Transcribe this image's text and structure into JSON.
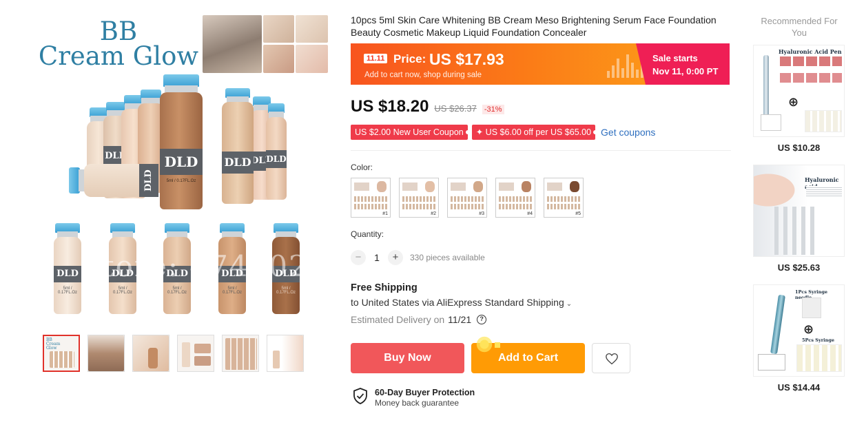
{
  "gallery": {
    "hero_title_line1": "BB",
    "hero_title_line2": "Cream Glow",
    "vial_label": "DLD",
    "vial_sub": "5ml / 0.17FL.Oz",
    "watermark": "Store: 4746024",
    "thumb_logo_text": "BB Cream Glow"
  },
  "product": {
    "title": "10pcs 5ml Skin Care Whitening BB Cream Meso Brightening Serum Face Foundation Beauty Cosmetic Makeup Liquid Foundation Concealer"
  },
  "sale_banner": {
    "tag": "11.11",
    "price_label": "Price:",
    "price_value": "US $17.93",
    "subtext": "Add to cart now, shop during sale",
    "start_line1": "Sale starts",
    "start_line2": "Nov 11, 0:00 PT"
  },
  "price": {
    "current": "US $18.20",
    "original": "US $26.37",
    "discount": "-31%"
  },
  "coupons": {
    "new_user": "US $2.00 New User Coupon",
    "store": "✦ US $6.00 off per US $65.00",
    "get_link": "Get coupons"
  },
  "color": {
    "label": "Color:",
    "options": [
      "#1",
      "#2",
      "#3",
      "#4",
      "#5"
    ]
  },
  "quantity": {
    "label": "Quantity:",
    "minus": "−",
    "value": "1",
    "plus": "+",
    "available": "330 pieces available"
  },
  "shipping": {
    "title": "Free Shipping",
    "line": "to United States via AliExpress Standard Shipping",
    "chevron": "⌄",
    "delivery_label": "Estimated Delivery on",
    "delivery_date": "11/21",
    "help": "?"
  },
  "actions": {
    "buy_now": "Buy Now",
    "add_to_cart": "Add to Cart"
  },
  "protection": {
    "title": "60-Day Buyer Protection",
    "desc": "Money back guarantee"
  },
  "recommended": {
    "title": "Recommended For You",
    "items": [
      {
        "price": "US $10.28",
        "caption": "Hyaluronic Acid Pen"
      },
      {
        "price": "US $25.63",
        "caption": "Hyaluronic acid"
      },
      {
        "price": "US $14.44",
        "caption": "1Pcs Syringe needle",
        "caption2": "5Pcs Syringe"
      }
    ]
  },
  "colors": {
    "accent_red": "#f1575a",
    "accent_orange": "#ff9b05",
    "sale_pink": "#ef1f55",
    "coupon_red": "#ef3b4a",
    "link_blue": "#2e6fbf"
  }
}
